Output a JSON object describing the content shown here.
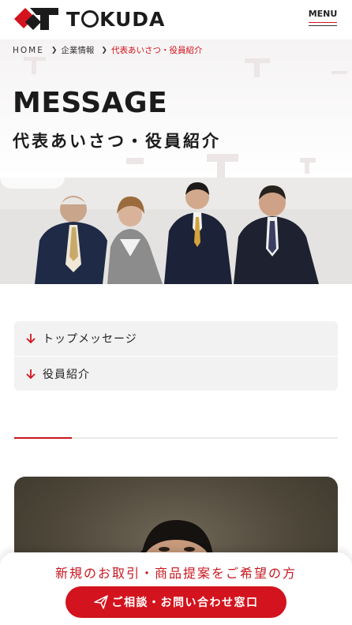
{
  "header": {
    "logo_text_before": "T",
    "logo_text_after": "KUDA",
    "menu_label": "MENU"
  },
  "breadcrumb": {
    "items": [
      "HOME",
      "企業情報",
      "代表あいさつ・役員紹介"
    ]
  },
  "page": {
    "title": "MESSAGE",
    "subtitle": "代表あいさつ・役員紹介"
  },
  "anchor_nav": {
    "items": [
      "トップメッセージ",
      "役員紹介"
    ]
  },
  "cta": {
    "text": "新規のお取引・商品提案をご希望の方",
    "button_label": "ご相談・お問い合わせ窓口",
    "button_icon": "paper-plane-icon"
  },
  "colors": {
    "brand_red": "#d3131d",
    "text_dark": "#1b1b1b",
    "nav_bg": "#f3f2f2"
  }
}
